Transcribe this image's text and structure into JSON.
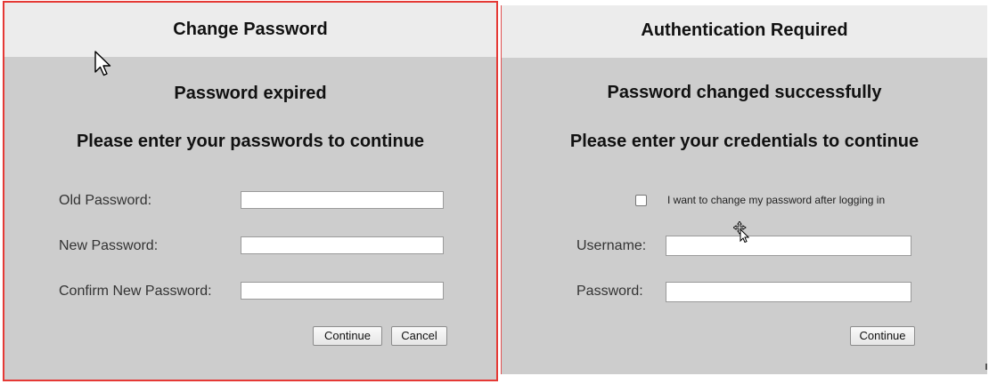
{
  "change_password": {
    "title": "Change Password",
    "heading1": "Password expired",
    "heading2": "Please enter your passwords to continue",
    "old_password_label": "Old Password:",
    "new_password_label": "New Password:",
    "confirm_password_label": "Confirm New Password:",
    "old_password_value": "",
    "new_password_value": "",
    "confirm_password_value": "",
    "continue_label": "Continue",
    "cancel_label": "Cancel",
    "accent_border": "#e53935"
  },
  "authentication": {
    "title": "Authentication Required",
    "heading1": "Password changed successfully",
    "heading2": "Please enter your credentials to continue",
    "checkbox_label": "I want to change my password after logging in",
    "checkbox_checked": false,
    "username_label": "Username:",
    "password_label": "Password:",
    "username_value": "",
    "password_value": "",
    "continue_label": "Continue"
  },
  "icons": {
    "pointer": "arrow-cursor-icon",
    "move": "move-cursor-icon"
  }
}
